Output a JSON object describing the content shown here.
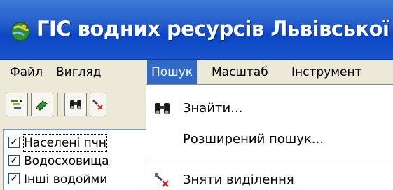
{
  "window": {
    "title": "ГІС водних ресурсів Львівської обл",
    "icon": "app-globe-icon"
  },
  "menubar": {
    "items": [
      {
        "label": "Файл"
      },
      {
        "label": "Вигляд"
      },
      {
        "label": "Пошук",
        "active": true
      },
      {
        "label": "Масштаб"
      },
      {
        "label": "Інструмент"
      }
    ]
  },
  "toolbar": {
    "buttons": [
      {
        "icon": "layer-add-icon"
      },
      {
        "icon": "eraser-icon"
      },
      {
        "icon": "binoculars-icon"
      },
      {
        "icon": "clear-selection-icon"
      }
    ]
  },
  "layers": {
    "items": [
      {
        "label": "Населені пчн",
        "checked": true
      },
      {
        "label": "Водосховища",
        "checked": true
      },
      {
        "label": "Інші водойми",
        "checked": true
      }
    ]
  },
  "search_menu": {
    "items": [
      {
        "label": "Знайти...",
        "icon": "binoculars-icon"
      },
      {
        "label": "Розширений пошук...",
        "icon": ""
      },
      {
        "label": "Зняти виділення",
        "icon": "clear-selection-icon"
      }
    ]
  },
  "colors": {
    "titlebar": "#0b46c4",
    "menu_highlight": "#316ac5",
    "chrome": "#ece9d8"
  }
}
